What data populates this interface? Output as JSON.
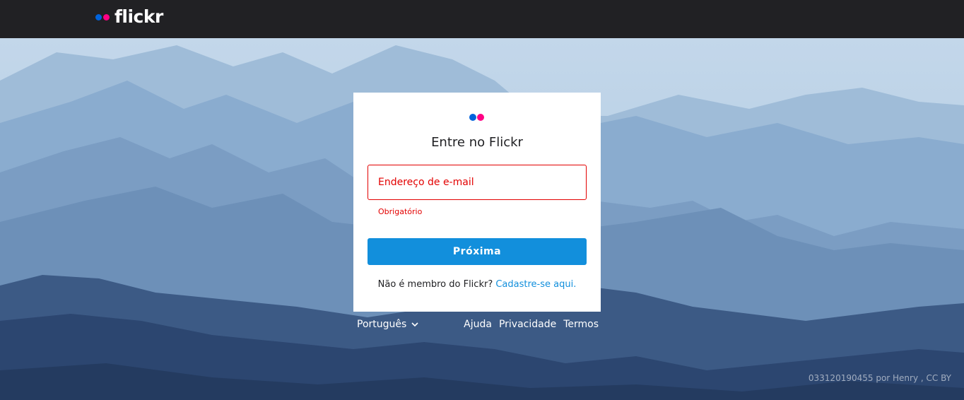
{
  "header": {
    "logo_text": "flickr",
    "logo_dot_colors": [
      "#0063dc",
      "#ff0084"
    ]
  },
  "login": {
    "title": "Entre no Flickr",
    "email_placeholder": "Endereço de e-mail",
    "email_value": "",
    "error_text": "Obrigatório",
    "next_label": "Próxima",
    "signup_prompt": "Não é membro do Flickr?",
    "signup_link": "Cadastre-se aqui."
  },
  "footer": {
    "language": "Português",
    "links": [
      "Ajuda",
      "Privacidade",
      "Termos"
    ]
  },
  "photo_credit": "033120190455 por Henry , CC BY",
  "colors": {
    "topbar": "#212124",
    "error": "#e30000",
    "primary": "#128fdc",
    "brand_blue": "#0063dc",
    "brand_pink": "#ff0084"
  }
}
